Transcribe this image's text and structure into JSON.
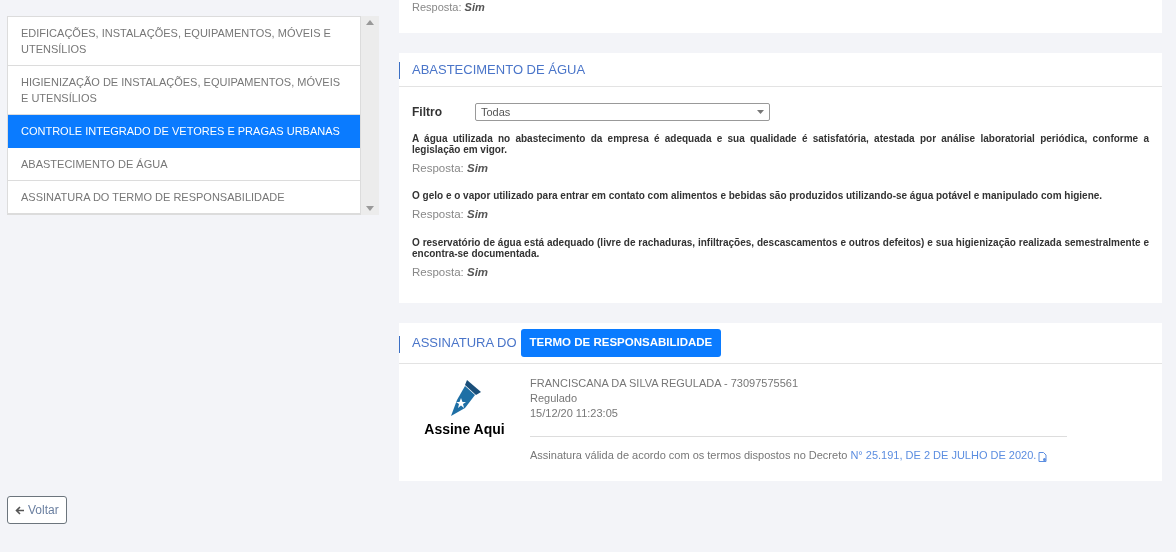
{
  "sidebar": {
    "items": [
      {
        "label": "EDIFICAÇÕES, INSTALAÇÕES, EQUIPAMENTOS, MÓVEIS E UTENSÍLIOS",
        "selected": false
      },
      {
        "label": "HIGIENIZAÇÃO DE INSTALAÇÕES, EQUIPAMENTOS, MÓVEIS E UTENSÍLIOS",
        "selected": false
      },
      {
        "label": "CONTROLE INTEGRADO DE VETORES E PRAGAS URBANAS",
        "selected": true
      },
      {
        "label": "ABASTECIMENTO DE ÁGUA",
        "selected": false
      },
      {
        "label": "ASSINATURA DO TERMO DE RESPONSABILIDADE",
        "selected": false
      }
    ]
  },
  "previous_section": {
    "answer_label": "Resposta:",
    "answer": "Sim"
  },
  "water_section": {
    "title": "ABASTECIMENTO DE ÁGUA",
    "filter_label": "Filtro",
    "filter_value": "Todas",
    "questions": [
      {
        "text": "A água utilizada no abastecimento da empresa é adequada e sua qualidade é satisfatória, atestada por análise laboratorial periódica, conforme a legislação em vigor.",
        "answer_label": "Resposta:",
        "answer": "Sim"
      },
      {
        "text": "O gelo e o vapor utilizado para entrar em contato com alimentos e bebidas são produzidos utilizando-se água potável e manipulado com higiene.",
        "answer_label": "Resposta:",
        "answer": "Sim"
      },
      {
        "text": "O reservatório de água está adequado (livre de rachaduras, infiltrações, descascamentos e outros defeitos) e sua higienização realizada semestralmente e encontra-se documentada.",
        "answer_label": "Resposta:",
        "answer": "Sim"
      }
    ]
  },
  "signature_section": {
    "title": "ASSINATURA DO",
    "title_button": "TERMO DE RESPONSABILIDADE",
    "logo_text": "Assine Aqui",
    "signer": "FRANCISCANA DA SILVA REGULADA - 73097575561",
    "role": "Regulado",
    "timestamp": "15/12/20 11:23:05",
    "note": "Assinatura válida de acordo com os termos dispostos no Decreto",
    "note_link": "N° 25.191, DE 2 DE JULHO DE 2020."
  },
  "back_button": "Voltar"
}
